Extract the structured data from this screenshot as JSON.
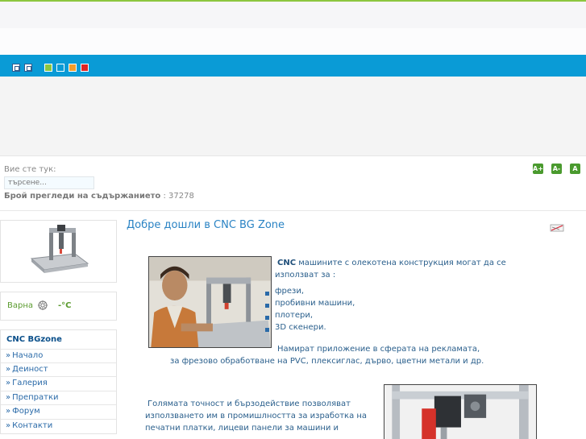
{
  "breadcrumb": {
    "label": "Вие сте тук:"
  },
  "search": {
    "placeholder": "търсене..."
  },
  "views": {
    "label": "Брой прегледи на съдържанието",
    "count": "37278"
  },
  "font_controls": [
    "A+",
    "A-",
    "A"
  ],
  "weather": {
    "city": "Варна",
    "temp": "-°C"
  },
  "menu": {
    "title": "CNC BGzone",
    "items": [
      "Начало",
      "Деиност",
      "Галерия",
      "Препратки",
      "Форум",
      "Контакти"
    ]
  },
  "article": {
    "title": "Добре дошли в CNC BG Zone",
    "intro_bold": "CNC",
    "intro_rest": " машините с олекотена конструкция могат да се",
    "intro_line2": "използват за :",
    "uses": [
      "фрези,",
      "пробивни машини,",
      "плотери,",
      "3D скенери."
    ],
    "apply_line1": "Намират приложение в сферата на рекламата,",
    "apply_line2": "за фрезово обработване на PVC, плексиглас, дърво, цветни метали и др.",
    "para2_line1": "Голямата точност и бързодействие позволяват",
    "para2_line2": "използването им в промишлността за изработка на",
    "para2_line3": "печатни платки, лицеви панели за машини и"
  },
  "colors": {
    "accent_blue": "#0a9bd6",
    "green": "#8cc63f",
    "link": "#2a6aa8"
  },
  "toolbar": {
    "color_swatches": [
      "#8cc63f",
      "#0a9bd6",
      "#f39c2a",
      "#e02424"
    ]
  }
}
